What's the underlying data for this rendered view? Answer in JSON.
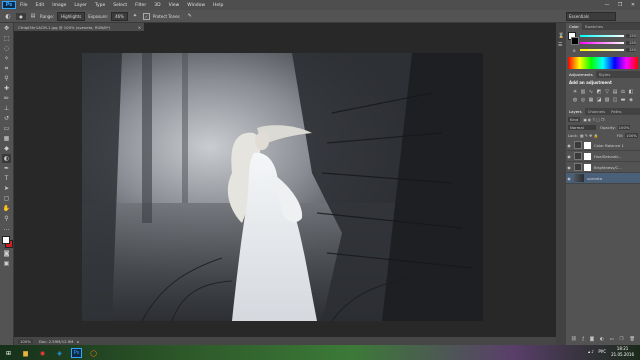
{
  "app": {
    "logo": "Ps"
  },
  "menu": [
    "File",
    "Edit",
    "Image",
    "Layer",
    "Type",
    "Select",
    "Filter",
    "3D",
    "View",
    "Window",
    "Help"
  ],
  "window_controls": [
    "—",
    "❐",
    "✕"
  ],
  "options": {
    "range_label": "Range:",
    "range_value": "Highlights",
    "exposure_label": "Exposure:",
    "exposure_value": "46%",
    "protect_tones_label": "Protect Tones",
    "workspace": "Essentials"
  },
  "document": {
    "tab_title": "CfrdpI5hr1ACM-1.jpg @ 100% (sveneta, RGB/8*)",
    "close_glyph": "✕",
    "zoom": "100%",
    "doc_info": "Doc: 2.59M/12.9M"
  },
  "panels": {
    "color_tabs": [
      "Color",
      "Swatches"
    ],
    "sliders": [
      {
        "label": "R",
        "value": "255"
      },
      {
        "label": "G",
        "value": "255"
      },
      {
        "label": "B",
        "value": "255"
      }
    ],
    "adjustments_tabs": [
      "Adjustments",
      "Styles"
    ],
    "adjustments_title": "Add an adjustment",
    "layers_tabs": [
      "Layers",
      "Channels",
      "Paths"
    ],
    "kind_label": "Kind",
    "blend_mode": "Normal",
    "opacity_label": "Opacity:",
    "opacity_value": "100%",
    "lock_label": "Lock:",
    "fill_label": "Fill:",
    "fill_value": "100%",
    "layers": [
      {
        "name": "Color Balance 1",
        "type": "adjustment",
        "selected": false
      },
      {
        "name": "Hue/Saturati...",
        "type": "adjustment",
        "selected": false
      },
      {
        "name": "Brightness/C...",
        "type": "adjustment",
        "selected": false
      },
      {
        "name": "sveneta",
        "type": "image",
        "selected": true
      }
    ]
  },
  "taskbar": {
    "lang": "РУС",
    "time": "18:21",
    "date": "21.05.2016"
  },
  "colors": {
    "ui_dark": "#282828",
    "panel": "#535353",
    "selected_layer": "#4a6079",
    "ps_blue": "#31a8ff"
  }
}
